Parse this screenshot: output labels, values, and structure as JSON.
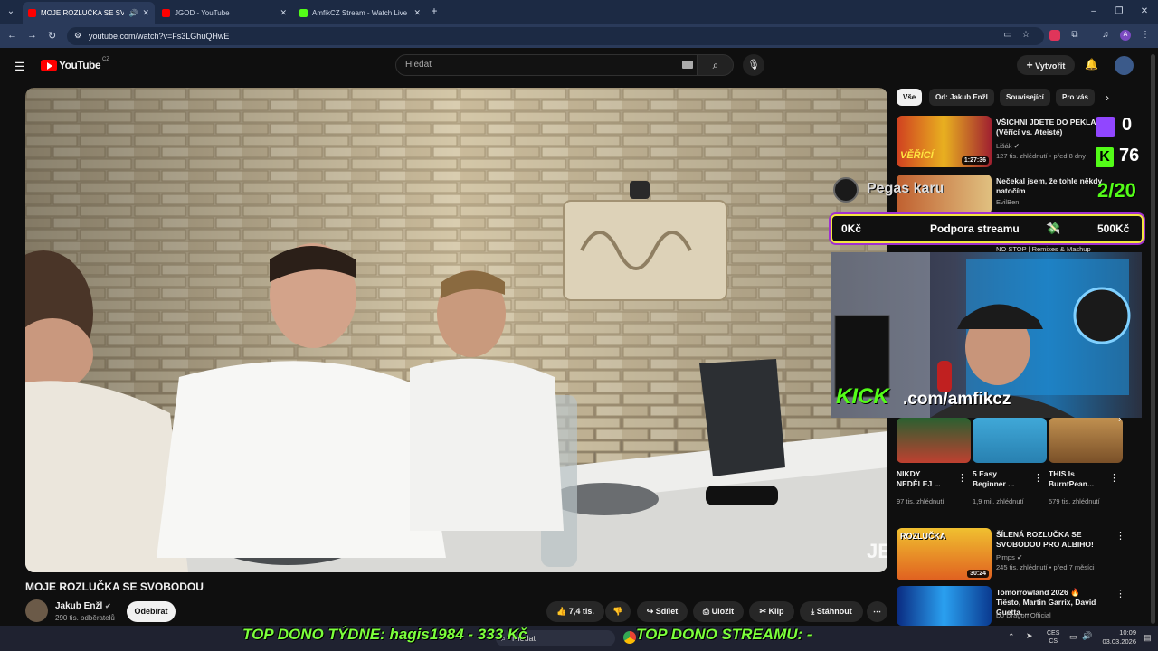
{
  "browser": {
    "tabs": [
      {
        "title": "MOJE ROZLUČKA SE SVOBO",
        "favicon_color": "#ff0000"
      },
      {
        "title": "JGOD - YouTube",
        "favicon_color": "#ff0000"
      },
      {
        "title": "AmfikCZ Stream - Watch Live o",
        "favicon_color": "#53fc18"
      }
    ],
    "new_tab": "+",
    "url": "youtube.com/watch?v=Fs3LGhuQHwE"
  },
  "youtube": {
    "logo": "YouTube",
    "logo_region": "CZ",
    "search_placeholder": "Hledat",
    "create_label": "Vytvořit"
  },
  "video": {
    "title": "MOJE ROZLUČKA SE SVOBODOU",
    "channel": "Jakub Enžl",
    "subscribers": "290 tis. odběratelů",
    "subscribe_label": "Odebírat",
    "likes": "7,4 tis.",
    "share_label": "Sdílet",
    "save_label": "Uložit",
    "clip_label": "Klip",
    "download_label": "Stáhnout"
  },
  "chips": [
    "Vše",
    "Od: Jakub Enžl",
    "Související",
    "Pro vás"
  ],
  "recommendations": [
    {
      "title": "VŠICHNI JDETE DO PEKLA! (Věřící vs. Ateisté)",
      "channel": "Lišák",
      "meta": "127 tis. zhlédnutí • před 8 dny",
      "duration": "1:27:36",
      "thumb_text": "VĚŘÍCÍ",
      "thumb_color": "#d04020"
    },
    {
      "title": "Nečekal jsem, že tohle někdy natočím",
      "channel": "EvilBen",
      "meta": "",
      "duration": "",
      "thumb_text": "",
      "thumb_color": "#c06030"
    },
    {
      "title": "NO STOP | Remixes & Mashup",
      "channel": "",
      "meta": "",
      "duration": "",
      "thumb_text": "",
      "thumb_color": "#303040"
    }
  ],
  "shorts": [
    {
      "title": "NIKDY NEDĚLEJ ...",
      "views": "97 tis. zhlédnutí"
    },
    {
      "title": "5 Easy Beginner ...",
      "views": "1,9 mil. zhlédnutí"
    },
    {
      "title": "THIS Is BurntPean...",
      "views": "579 tis. zhlédnutí"
    }
  ],
  "recommendations_bottom": [
    {
      "title": "ŠÍLENÁ ROZLUČKA SE SVOBODOU PRO ALBIHO!",
      "channel": "Pimps",
      "meta": "245 tis. zhlédnutí • před 7 měsíci",
      "duration": "30:24",
      "thumb_text": "ROZLUČKA",
      "thumb_color": "#e0a020"
    },
    {
      "title": "Tomorrowland 2026 🔥 Tiësto, Martin Garrix, David Guetta, ...",
      "channel": "DJ Dragon Official",
      "meta": "",
      "duration": "",
      "thumb_text": "",
      "thumb_color": "#1a60c0"
    }
  ],
  "overlay": {
    "twitch_count": "0",
    "kick_count": "76",
    "goal": "2/20",
    "pegas_text": "Pegas karu",
    "support_left": "0Kč",
    "support_label": "Podpora streamu",
    "support_right": "500Kč",
    "kick_url_brand": "KICK",
    "kick_url_rest": ".com/amfikcz",
    "top_week": "TOP DONO TÝDNE:  hagis1984 - 333 Kč",
    "top_stream": "TOP DONO STREAMU: -"
  },
  "taskbar": {
    "search": "Hledat",
    "lang_top": "CES",
    "lang_bottom": "CS",
    "time": "10:09",
    "date": "03.03.2026"
  }
}
